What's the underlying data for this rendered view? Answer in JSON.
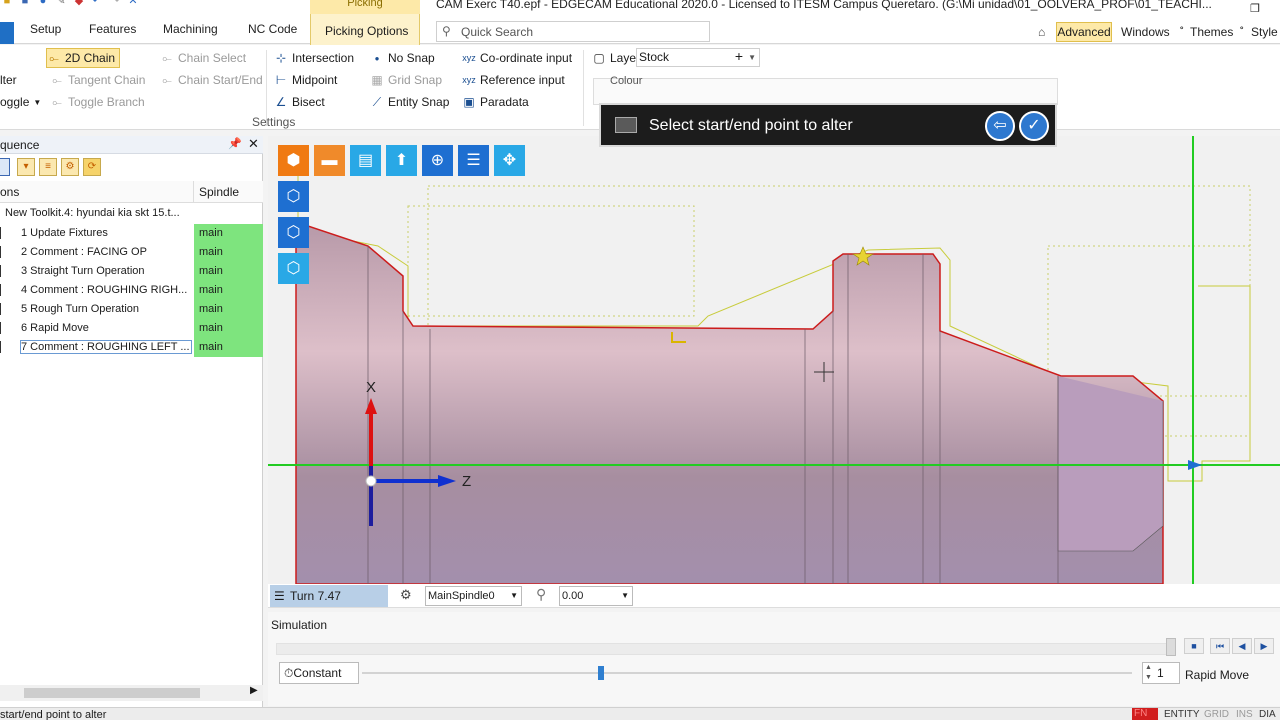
{
  "window": {
    "title": "CAM Exerc T40.epf - EDGECAM Educational 2020.0  - Licensed to ITESM Campus Queretaro. (G:\\Mi unidad\\01_OOLVERA_PROF\\01_TEACHI...",
    "context_tab": "Picking"
  },
  "tabs": [
    "Setup",
    "Features",
    "Machining",
    "NC Code",
    "Picking Options"
  ],
  "search": {
    "placeholder": "Quick Search"
  },
  "right_tabs": {
    "advanced": "Advanced",
    "windows": "Windows",
    "themes": "Themes",
    "style": "Style"
  },
  "ribbon": {
    "filter": "lter",
    "toggle": "oggle",
    "chain_2d": "2D Chain",
    "tangent_chain": "Tangent Chain",
    "toggle_branch": "Toggle Branch",
    "chain_select": "Chain Select",
    "chain_start_end": "Chain Start/End",
    "intersection": "Intersection",
    "midpoint": "Midpoint",
    "bisect": "Bisect",
    "no_snap": "No Snap",
    "grid_snap": "Grid Snap",
    "entity_snap": "Entity Snap",
    "coordinate_input": "Co-ordinate input",
    "reference_input": "Reference input",
    "paradata": "Paradata",
    "layer_label": "Layer",
    "layer_value": "Stock",
    "settings_group": "Settings",
    "colour_label": "Colour"
  },
  "sequence_panel": {
    "title": "quence",
    "col_operations": "ons",
    "col_spindle": "Spindle",
    "toolkit": "New Toolkit.4: hyundai kia skt 15.t...",
    "rows": [
      {
        "name": "1 Update Fixtures",
        "spindle": "main"
      },
      {
        "name": "2 Comment : FACING OP",
        "spindle": "main"
      },
      {
        "name": "3 Straight Turn Operation",
        "spindle": "main"
      },
      {
        "name": "4 Comment : ROUGHING RIGH...",
        "spindle": "main"
      },
      {
        "name": "5 Rough Turn Operation",
        "spindle": "main"
      },
      {
        "name": "6 Rapid Move",
        "spindle": "main"
      },
      {
        "name": "7 Comment : ROUGHING LEFT ...",
        "spindle": "main"
      }
    ]
  },
  "viewport": {
    "prompt": "Select start/end point to alter",
    "axis_x": "X",
    "axis_z": "Z"
  },
  "view_status": {
    "turn": "Turn 7.47",
    "spindle": "MainSpindle0",
    "angle": "0.00"
  },
  "simulation": {
    "label": "Simulation",
    "constant": "Constant",
    "step": "1",
    "mode": "Rapid Move",
    "speed_fraction": 0.31
  },
  "statusbar": {
    "text": "start/end point to alter",
    "fn": "FN",
    "entity": "ENTITY",
    "grid": "GRID",
    "ins": "INS",
    "dia": "DIA"
  },
  "colors": {
    "accent": "#fde9a8",
    "spindle_main": "#7ee47e",
    "prompt_bg": "#1c1c1c"
  }
}
